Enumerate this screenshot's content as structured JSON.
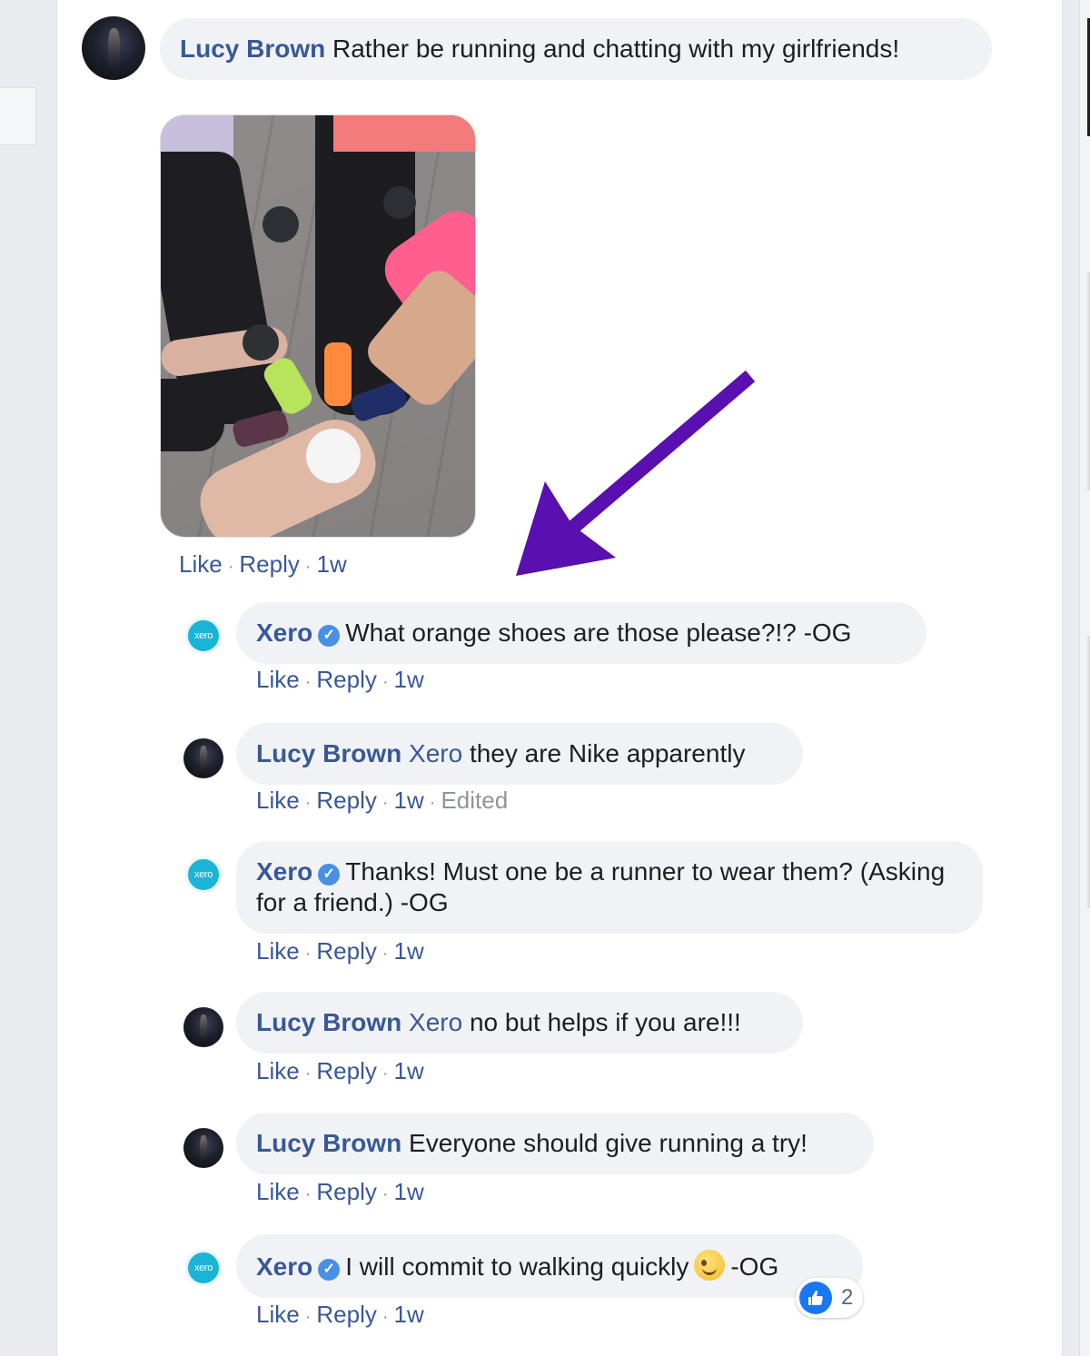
{
  "post_comment": {
    "author": "Lucy Brown",
    "text": "Rather be running and chatting with my girlfriends!",
    "actions": {
      "like": "Like",
      "reply": "Reply",
      "time": "1w"
    }
  },
  "replies": [
    {
      "author": "Xero",
      "mention": "",
      "text": "What orange shoes are those please?!? -OG",
      "actions": {
        "like": "Like",
        "reply": "Reply",
        "time": "1w"
      }
    },
    {
      "author": "Lucy Brown",
      "mention": "Xero",
      "text": "they are Nike apparently",
      "actions": {
        "like": "Like",
        "reply": "Reply",
        "time": "1w",
        "edited": "Edited"
      }
    },
    {
      "author": "Xero",
      "mention": "",
      "text": "Thanks! Must one be a runner to wear them? (Asking for a friend.) -OG",
      "actions": {
        "like": "Like",
        "reply": "Reply",
        "time": "1w"
      }
    },
    {
      "author": "Lucy Brown",
      "mention": "Xero",
      "text": "no but helps if you are!!!",
      "actions": {
        "like": "Like",
        "reply": "Reply",
        "time": "1w"
      }
    },
    {
      "author": "Lucy Brown",
      "mention": "",
      "text": "Everyone should give running a try!",
      "actions": {
        "like": "Like",
        "reply": "Reply",
        "time": "1w"
      }
    },
    {
      "author": "Xero",
      "mention": "",
      "text_before": "I will commit to walking quickly",
      "text_after": "-OG",
      "actions": {
        "like": "Like",
        "reply": "Reply",
        "time": "1w"
      },
      "reaction_count": "2"
    }
  ],
  "xero_logo_text": "xero",
  "colors": {
    "link": "#385898",
    "bubble": "#f0f2f5",
    "arrow": "#5a0fb0",
    "xero": "#1ab4d7"
  }
}
